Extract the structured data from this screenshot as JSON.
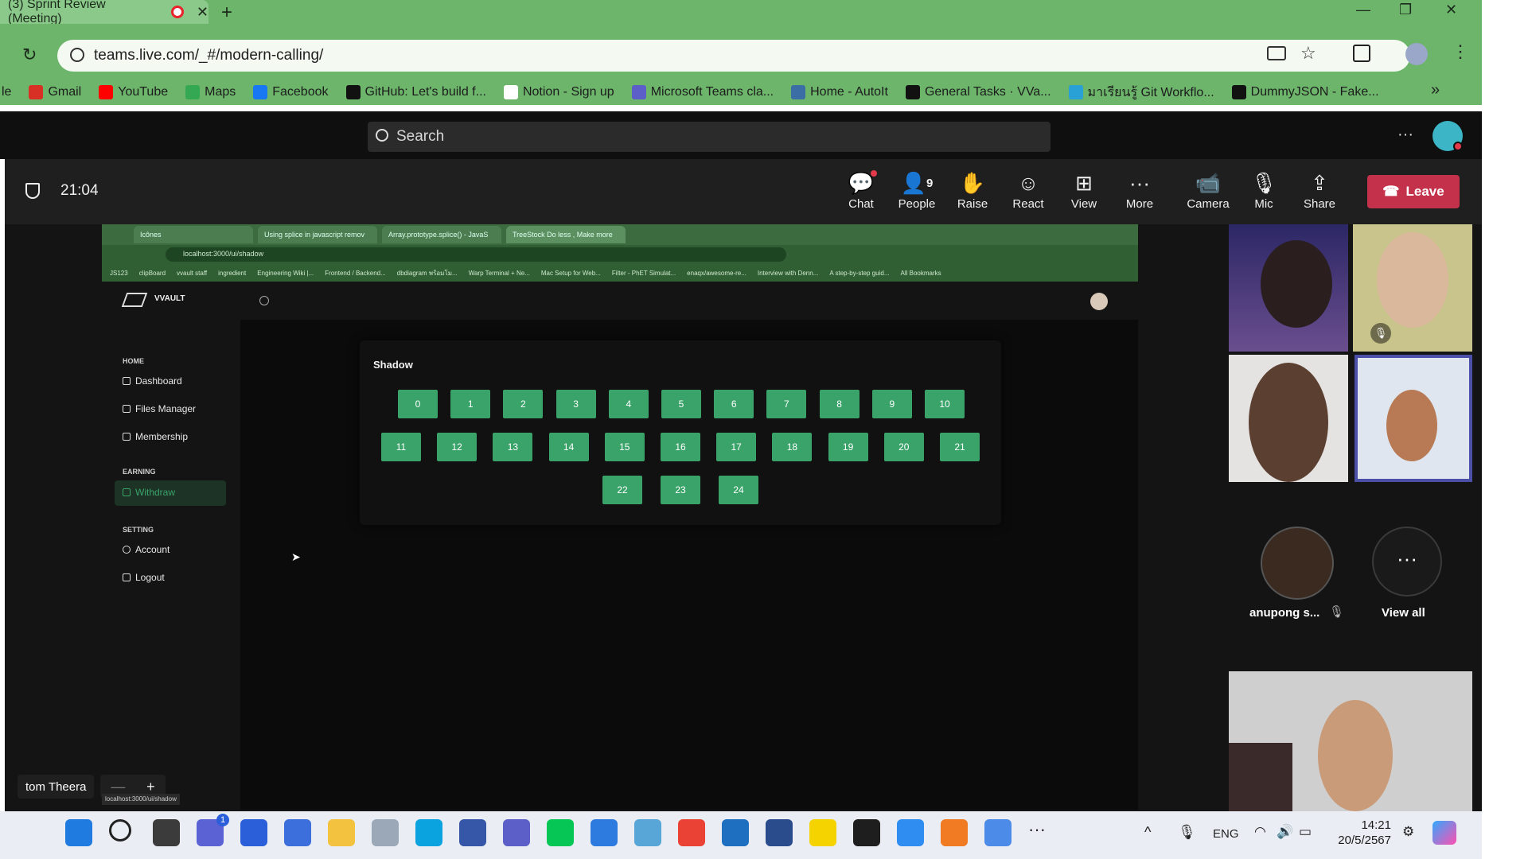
{
  "browser": {
    "tab_title": "(3) Sprint Review (Meeting)",
    "new_tab": "+",
    "url": "teams.live.com/_#/modern-calling/",
    "bookmarks": [
      {
        "label": "le",
        "color": "#6cb56b"
      },
      {
        "label": "Gmail",
        "color": "#d93025"
      },
      {
        "label": "YouTube",
        "color": "#ff0000"
      },
      {
        "label": "Maps",
        "color": "#34a853"
      },
      {
        "label": "Facebook",
        "color": "#1877f2"
      },
      {
        "label": "GitHub: Let's build f...",
        "color": "#111111"
      },
      {
        "label": "Notion - Sign up",
        "color": "#ffffff"
      },
      {
        "label": "Microsoft Teams cla...",
        "color": "#5b5fc7"
      },
      {
        "label": "Home - AutoIt",
        "color": "#3a6ea5"
      },
      {
        "label": "General Tasks · VVa...",
        "color": "#111111"
      },
      {
        "label": "มาเรียนรู้ Git Workflo...",
        "color": "#2aa1d6"
      },
      {
        "label": "DummyJSON - Fake...",
        "color": "#111111"
      }
    ],
    "bookmarks_overflow": "»"
  },
  "teams": {
    "search_placeholder": "Search",
    "more_dots": "···",
    "timer": "21:04",
    "controls": [
      {
        "label": "Chat",
        "icon": "chat-icon"
      },
      {
        "label": "People",
        "icon": "people-icon",
        "count": "9"
      },
      {
        "label": "Raise",
        "icon": "raise-hand-icon"
      },
      {
        "label": "React",
        "icon": "react-icon"
      },
      {
        "label": "View",
        "icon": "view-icon"
      },
      {
        "label": "More",
        "icon": "more-icon"
      },
      {
        "label": "Camera",
        "icon": "camera-icon"
      },
      {
        "label": "Mic",
        "icon": "mic-icon"
      },
      {
        "label": "Share",
        "icon": "share-icon"
      }
    ],
    "leave_label": "Leave",
    "leave_color": "#c4314b",
    "participant_name": "anupong s...",
    "view_all": "View all",
    "presenter": "tom Theera",
    "zoom_minus": "—",
    "zoom_plus": "+",
    "status_url": "localhost:3000/ui/shadow"
  },
  "shared": {
    "tabs": [
      "Icônes",
      "Using splice in javascript remov",
      "Array.prototype.splice() - JavaS",
      "TreeStock Do less , Make more"
    ],
    "url": "localhost:3000/ui/shadow",
    "bookmarks": [
      "JS123",
      "clipBoard",
      "vvault staff",
      "ingredient",
      "Engineering Wiki |...",
      "Frontend / Backend...",
      "dbdiagram พร้อมโม...",
      "Warp Terminal + Ne...",
      "Mac Setup for Web...",
      "Filter - PhET Simulat...",
      "enaqx/awesome-re...",
      "Interview with Denn...",
      "A step-by-step guid...",
      "All Bookmarks"
    ],
    "logo": "VVAULT",
    "sidebar": {
      "home": "HOME",
      "dashboard": "Dashboard",
      "files": "Files Manager",
      "membership": "Membership",
      "earning": "EARNING",
      "withdraw": "Withdraw",
      "setting": "SETTING",
      "account": "Account",
      "logout": "Logout"
    },
    "card_title": "Shadow",
    "boxes_row1": [
      "0",
      "1",
      "2",
      "3",
      "4",
      "5",
      "6",
      "7",
      "8",
      "9",
      "10"
    ],
    "boxes_row2": [
      "11",
      "12",
      "13",
      "14",
      "15",
      "16",
      "17",
      "18",
      "19",
      "20",
      "21"
    ],
    "boxes_row3": [
      "22",
      "23",
      "24"
    ],
    "accent": "#3aa36a"
  },
  "taskbar": {
    "lang": "ENG",
    "time": "14:21",
    "date": "20/5/2567",
    "badge": "1"
  }
}
